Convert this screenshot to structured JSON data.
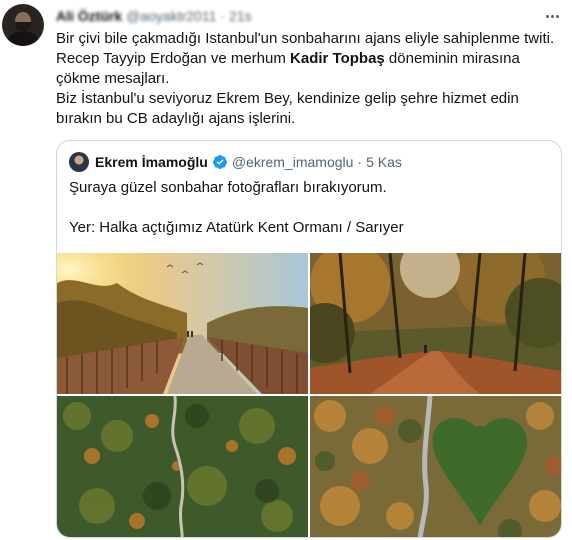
{
  "tweet": {
    "author_name": "Ali Öztürk",
    "author_handle": "@aoyaktr2011",
    "dot": "·",
    "time": "21s",
    "text": {
      "line1": "Bir çivi bile çakmadığı Istanbul'un sonbaharını ajans eliyle sahiplenme twiti.",
      "line2_pre": "Recep Tayyip Erdoğan ve merhum ",
      "line2_bold": "Kadir Topbaş",
      "line2_post": " döneminin mirasına çökme mesajları.",
      "line3": "Biz İstanbul'u seviyoruz Ekrem Bey, kendinize gelip şehre hizmet edin bırakın bu CB adaylığı ajans işlerini."
    }
  },
  "quoted": {
    "name": "Ekrem İmamoğlu",
    "handle": "@ekrem_imamoglu",
    "dot": "·",
    "time": "5 Kas",
    "text_line1": "Şuraya güzel sonbahar fotoğrafları bırakıyorum.",
    "text_line2": "",
    "text_line3": "Yer: Halka açtığımız Atatürk Kent Ormanı / Sarıyer"
  },
  "photos": [
    {
      "subject": "autumn-boardwalk-sunset"
    },
    {
      "subject": "forest-path-autumn"
    },
    {
      "subject": "aerial-forest-road"
    },
    {
      "subject": "aerial-heart-shaped-meadow"
    }
  ],
  "icons": {
    "more": "more-dots-icon",
    "verified": "verified-badge-icon"
  },
  "colors": {
    "text": "#0f1419",
    "secondary": "#536471",
    "border": "#cfd9de",
    "verified": "#1d9bf0"
  }
}
